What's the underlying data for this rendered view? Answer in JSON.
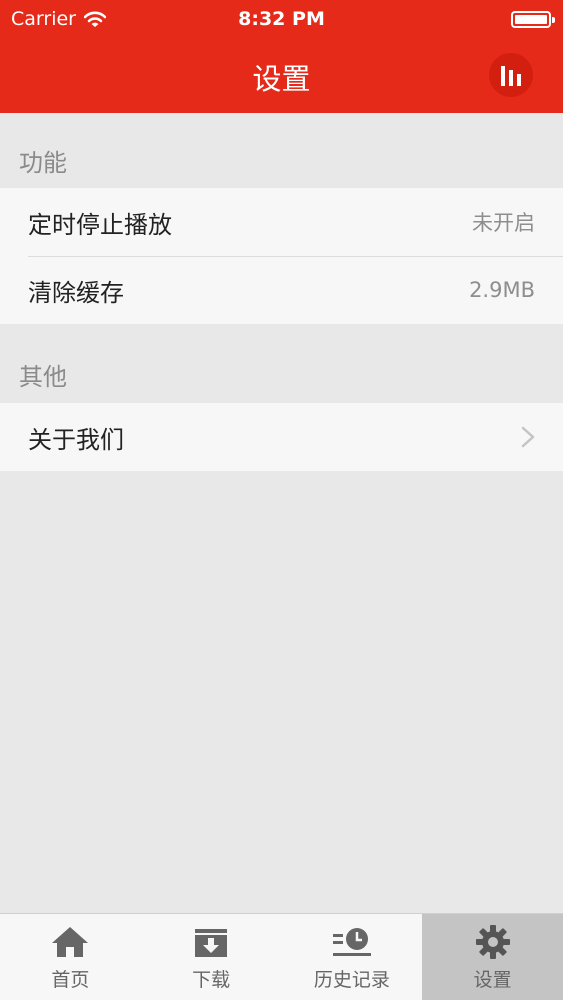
{
  "status_bar": {
    "carrier": "Carrier",
    "time": "8:32 PM"
  },
  "nav": {
    "title": "设置"
  },
  "sections": [
    {
      "title": "功能",
      "rows": [
        {
          "label": "定时停止播放",
          "value": "未开启"
        },
        {
          "label": "清除缓存",
          "value": "2.9MB"
        }
      ]
    },
    {
      "title": "其他",
      "rows": [
        {
          "label": "关于我们"
        }
      ]
    }
  ],
  "tabs": [
    {
      "label": "首页",
      "icon": "home-icon"
    },
    {
      "label": "下载",
      "icon": "download-icon"
    },
    {
      "label": "历史记录",
      "icon": "history-icon"
    },
    {
      "label": "设置",
      "icon": "gear-icon",
      "selected": true
    }
  ],
  "colors": {
    "accent": "#e52a19",
    "background": "#e8e8e9",
    "tab_selected": "#c4c4c4"
  }
}
